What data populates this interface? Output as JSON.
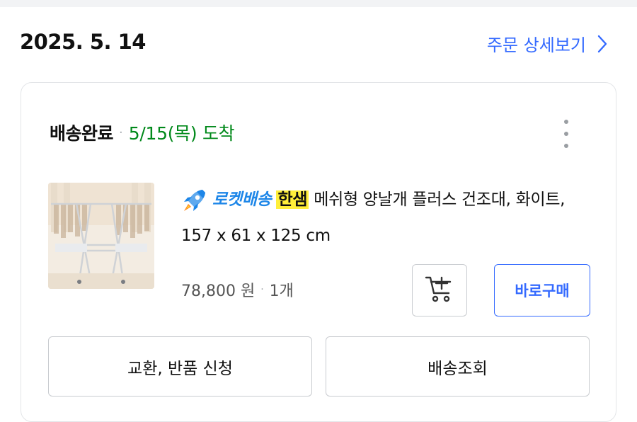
{
  "order": {
    "date": "2025. 5. 14",
    "detail_link_label": "주문 상세보기"
  },
  "shipment": {
    "status": "배송완료",
    "separator": "·",
    "arrival": "5/15(목) 도착",
    "status_color": "#111111",
    "arrival_color": "#00891a"
  },
  "product": {
    "delivery_badge": "로켓배송",
    "brand": "한샘",
    "name": "메쉬형 양날개 플러스 건조대, 화이트, 157 x 61 x 125 cm",
    "price": "78,800 원",
    "price_separator": "·",
    "quantity": "1개",
    "brand_highlight_color": "#ffef3a",
    "badge_color": "#1d86e8"
  },
  "actions": {
    "cart_icon": "cart-add-icon",
    "buy_now_label": "바로구매",
    "exchange_return_label": "교환, 반품 신청",
    "tracking_label": "배송조회"
  },
  "colors": {
    "accent": "#346aff",
    "border": "#c9ccd0",
    "card_border": "#e3e5e8"
  }
}
